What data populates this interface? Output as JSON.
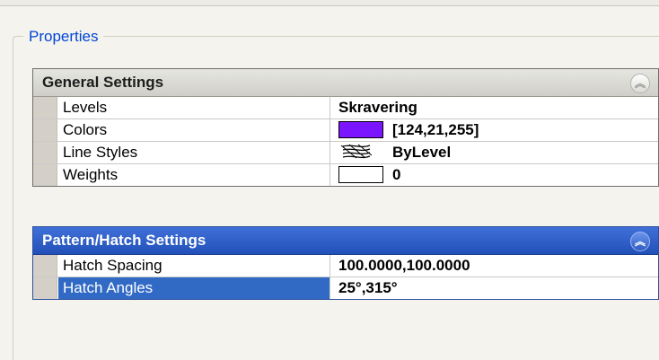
{
  "properties": {
    "title": "Properties"
  },
  "general": {
    "title": "General Settings",
    "rows": [
      {
        "label": "Levels",
        "value": "Skravering"
      },
      {
        "label": "Colors",
        "value": "[124,21,255]",
        "color": "#7c15ff"
      },
      {
        "label": "Line Styles",
        "value": "ByLevel",
        "icon": "line-style-icon"
      },
      {
        "label": "Weights",
        "value": "0",
        "icon": "weight-icon"
      }
    ]
  },
  "pattern": {
    "title": "Pattern/Hatch Settings",
    "rows": [
      {
        "label": "Hatch Spacing",
        "value": "100.0000,100.0000"
      },
      {
        "label": "Hatch Angles",
        "value": "25°,315°",
        "selected": true
      }
    ]
  },
  "colors": {
    "accent": "#0046d5",
    "selection": "#316ac5",
    "pattern_header": "#2250b8"
  }
}
